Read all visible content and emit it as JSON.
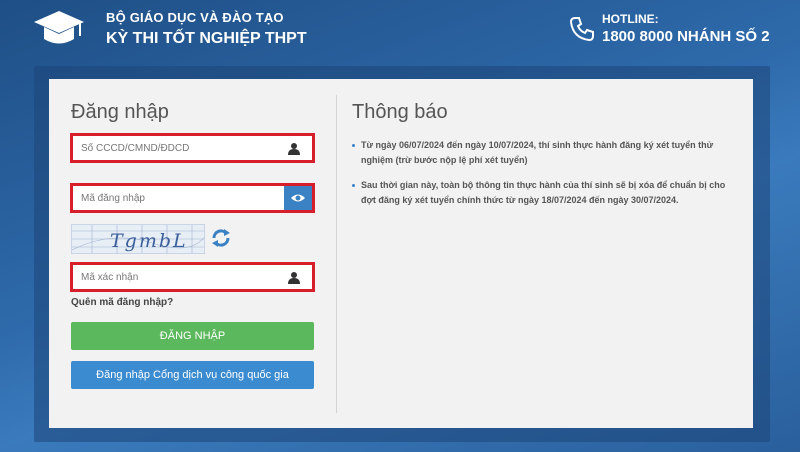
{
  "header": {
    "ministry": "BỘ GIÁO DỤC VÀ ĐÀO TẠO",
    "exam": "KỲ THI TỐT NGHIỆP THPT",
    "hotline_label": "HOTLINE:",
    "hotline_number": "1800 8000 NHÁNH SỐ 2",
    "logo_icon": "graduation-cap-icon",
    "phone_icon": "phone-icon"
  },
  "login": {
    "title": "Đăng nhập",
    "id_placeholder": "Số CCCD/CMND/ĐDCD",
    "password_placeholder": "Mã đăng nhập",
    "captcha_text": "TgmbL",
    "captcha_placeholder": "Mã xác nhận",
    "forgot_label": "Quên mã đăng nhập?",
    "login_button": "ĐĂNG NHẬP",
    "gov_button": "Đăng nhập Cổng dịch vụ công quốc gia"
  },
  "notice": {
    "title": "Thông báo",
    "items": [
      "Từ ngày 06/07/2024 đến ngày 10/07/2024, thí sinh thực hành đăng ký xét tuyển thử nghiệm (trừ bước nộp lệ phí xét tuyển)",
      "Sau thời gian này, toàn bộ thông tin thực hành của thí sinh sẽ bị xóa để chuẩn bị cho đợt đăng ký xét tuyển chính thức từ ngày 18/07/2024 đến ngày 30/07/2024."
    ]
  },
  "colors": {
    "highlight_border": "#d81e2a",
    "login_button": "#5cb85c",
    "gov_button": "#3b8bd0"
  }
}
